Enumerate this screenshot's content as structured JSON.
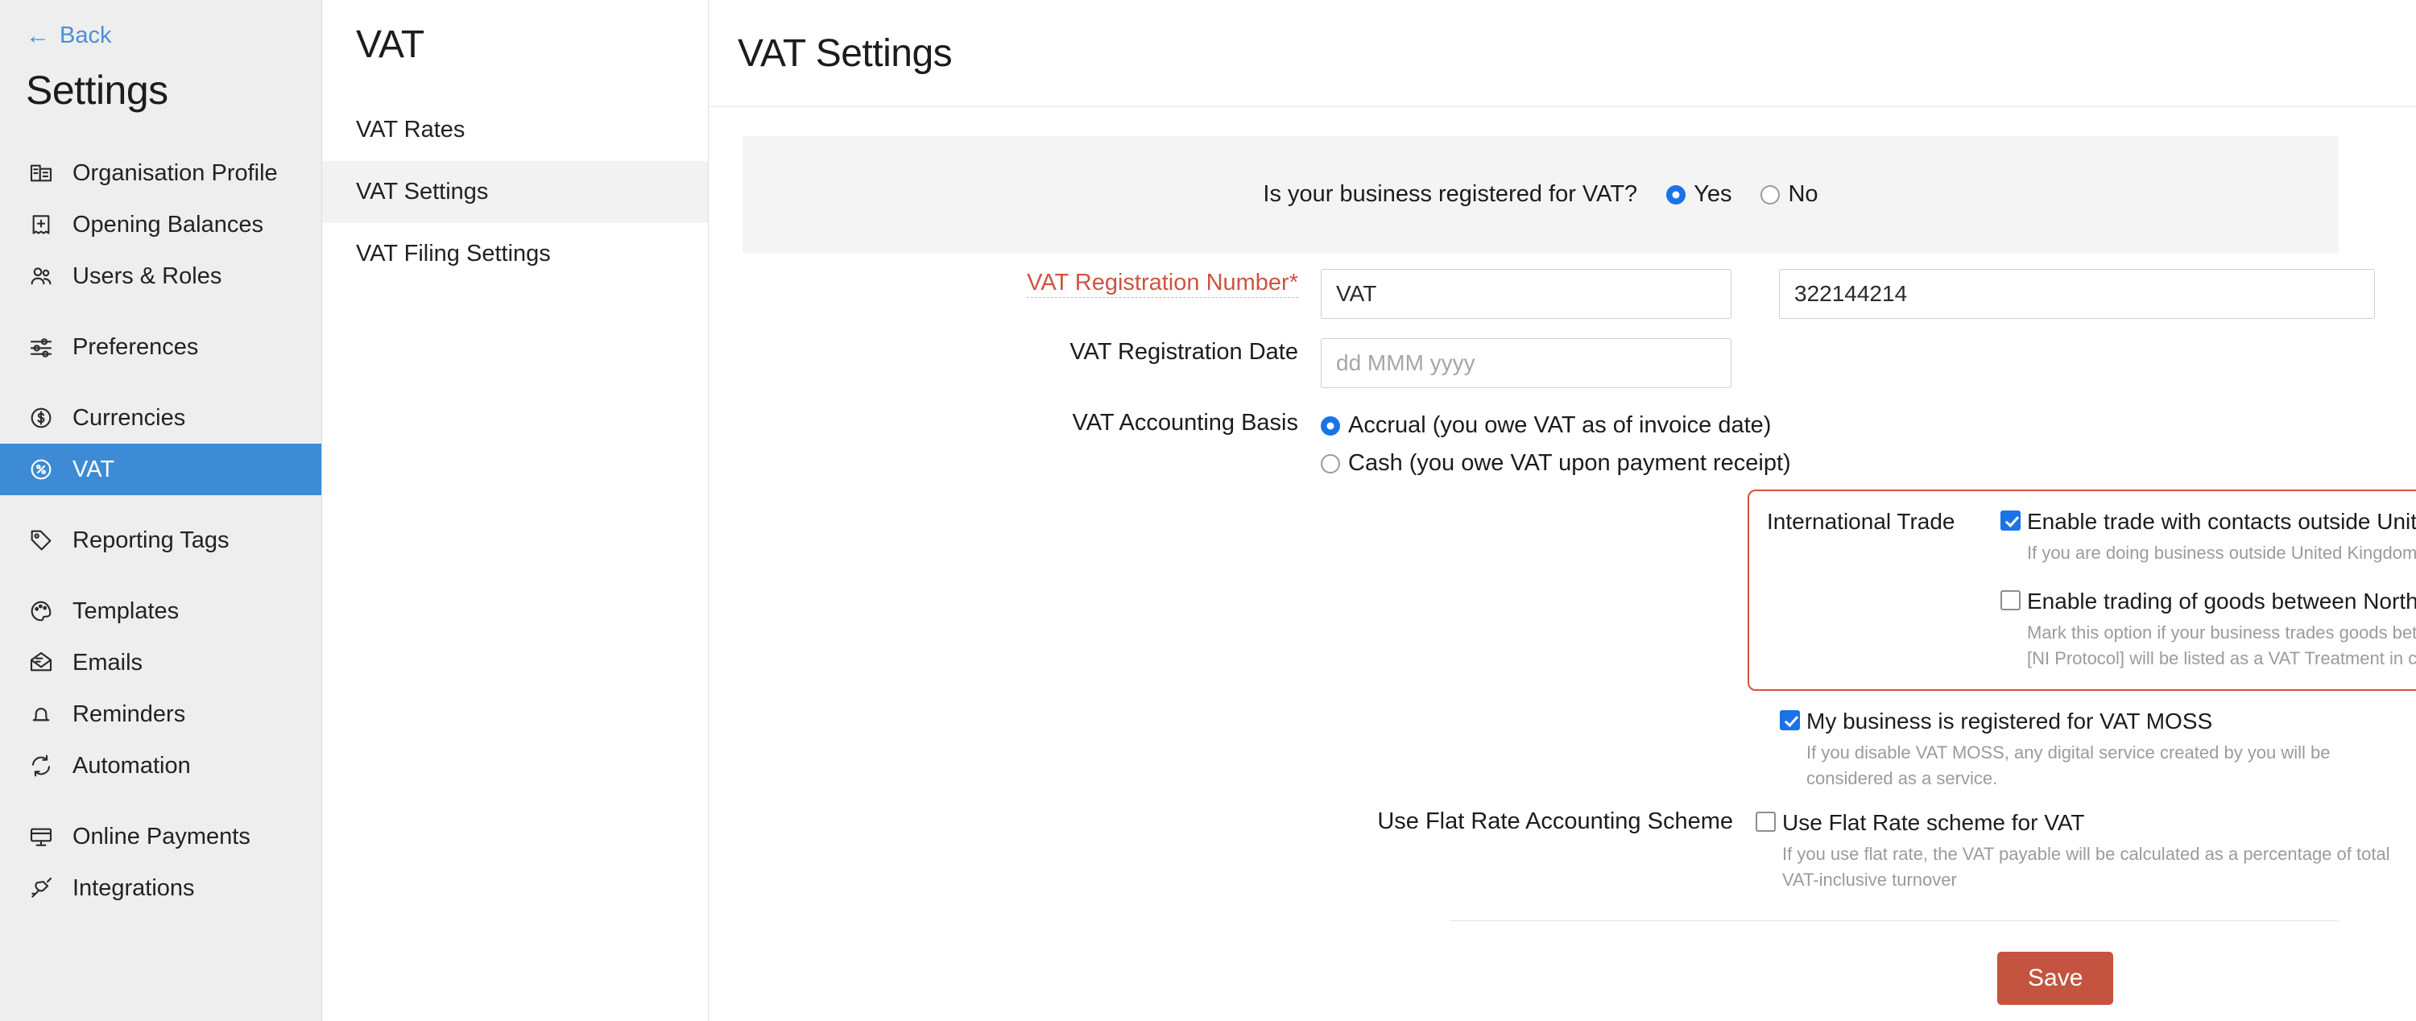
{
  "sidebar": {
    "back_label": "Back",
    "title": "Settings",
    "groups": [
      {
        "items": [
          {
            "label": "Organisation Profile",
            "icon": "building-icon",
            "active": false
          },
          {
            "label": "Opening Balances",
            "icon": "receipt-icon",
            "active": false
          },
          {
            "label": "Users & Roles",
            "icon": "users-icon",
            "active": false
          }
        ]
      },
      {
        "items": [
          {
            "label": "Preferences",
            "icon": "sliders-icon",
            "active": false
          }
        ]
      },
      {
        "items": [
          {
            "label": "Currencies",
            "icon": "currency-dollar-icon",
            "active": false
          },
          {
            "label": "VAT",
            "icon": "percent-circle-icon",
            "active": true
          }
        ]
      },
      {
        "items": [
          {
            "label": "Reporting Tags",
            "icon": "tag-icon",
            "active": false
          }
        ]
      },
      {
        "items": [
          {
            "label": "Templates",
            "icon": "palette-icon",
            "active": false
          },
          {
            "label": "Emails",
            "icon": "envelope-icon",
            "active": false
          },
          {
            "label": "Reminders",
            "icon": "bell-icon",
            "active": false
          },
          {
            "label": "Automation",
            "icon": "refresh-icon",
            "active": false
          }
        ]
      },
      {
        "items": [
          {
            "label": "Online Payments",
            "icon": "monitor-card-icon",
            "active": false
          },
          {
            "label": "Integrations",
            "icon": "plug-icon",
            "active": false
          }
        ]
      }
    ]
  },
  "submenu": {
    "title": "VAT",
    "items": [
      {
        "label": "VAT Rates",
        "active": false
      },
      {
        "label": "VAT Settings",
        "active": true
      },
      {
        "label": "VAT Filing Settings",
        "active": false
      }
    ]
  },
  "main": {
    "page_title": "VAT Settings",
    "registration_banner": {
      "question": "Is your business registered for VAT?",
      "yes_label": "Yes",
      "no_label": "No",
      "selected": "Yes"
    },
    "vat_registration_number": {
      "label": "VAT Registration Number*",
      "prefix_value": "VAT",
      "number_value": "322144214"
    },
    "vat_registration_date": {
      "label": "VAT Registration Date",
      "placeholder": "dd MMM yyyy",
      "value": ""
    },
    "accounting_basis": {
      "label": "VAT Accounting Basis",
      "options": [
        {
          "label": "Accrual (you owe VAT as of invoice date)",
          "selected": true
        },
        {
          "label": "Cash (you owe VAT upon payment receipt)",
          "selected": false
        }
      ]
    },
    "international_trade": {
      "label": "International Trade",
      "highlighted": true,
      "highlight_color": "#d9513a",
      "options": [
        {
          "label": "Enable trade with contacts outside United Kingdom",
          "checked": true,
          "help": "If you are doing business outside United Kingdom, enable this option for handling your imports and exports"
        },
        {
          "label": "Enable trading of goods between Northern Ireland and the European Union (NI Protocol)",
          "checked": false,
          "help": "Mark this option if your business trades goods between Northern Ireland and the EU. Once enabled, EU VAT Registered [NI Protocol] will be listed as a VAT Treatment in contacts and transactions."
        }
      ]
    },
    "vat_moss": {
      "label": "My business is registered for VAT MOSS",
      "checked": true,
      "help": "If you disable VAT MOSS, any digital service created by you will be considered as a service."
    },
    "flat_rate": {
      "section_label": "Use Flat Rate Accounting Scheme",
      "label": "Use Flat Rate scheme for VAT",
      "checked": false,
      "help": "If you use flat rate, the VAT payable will be calculated as a percentage of total VAT-inclusive turnover"
    },
    "save_label": "Save",
    "save_color": "#c4543f"
  }
}
